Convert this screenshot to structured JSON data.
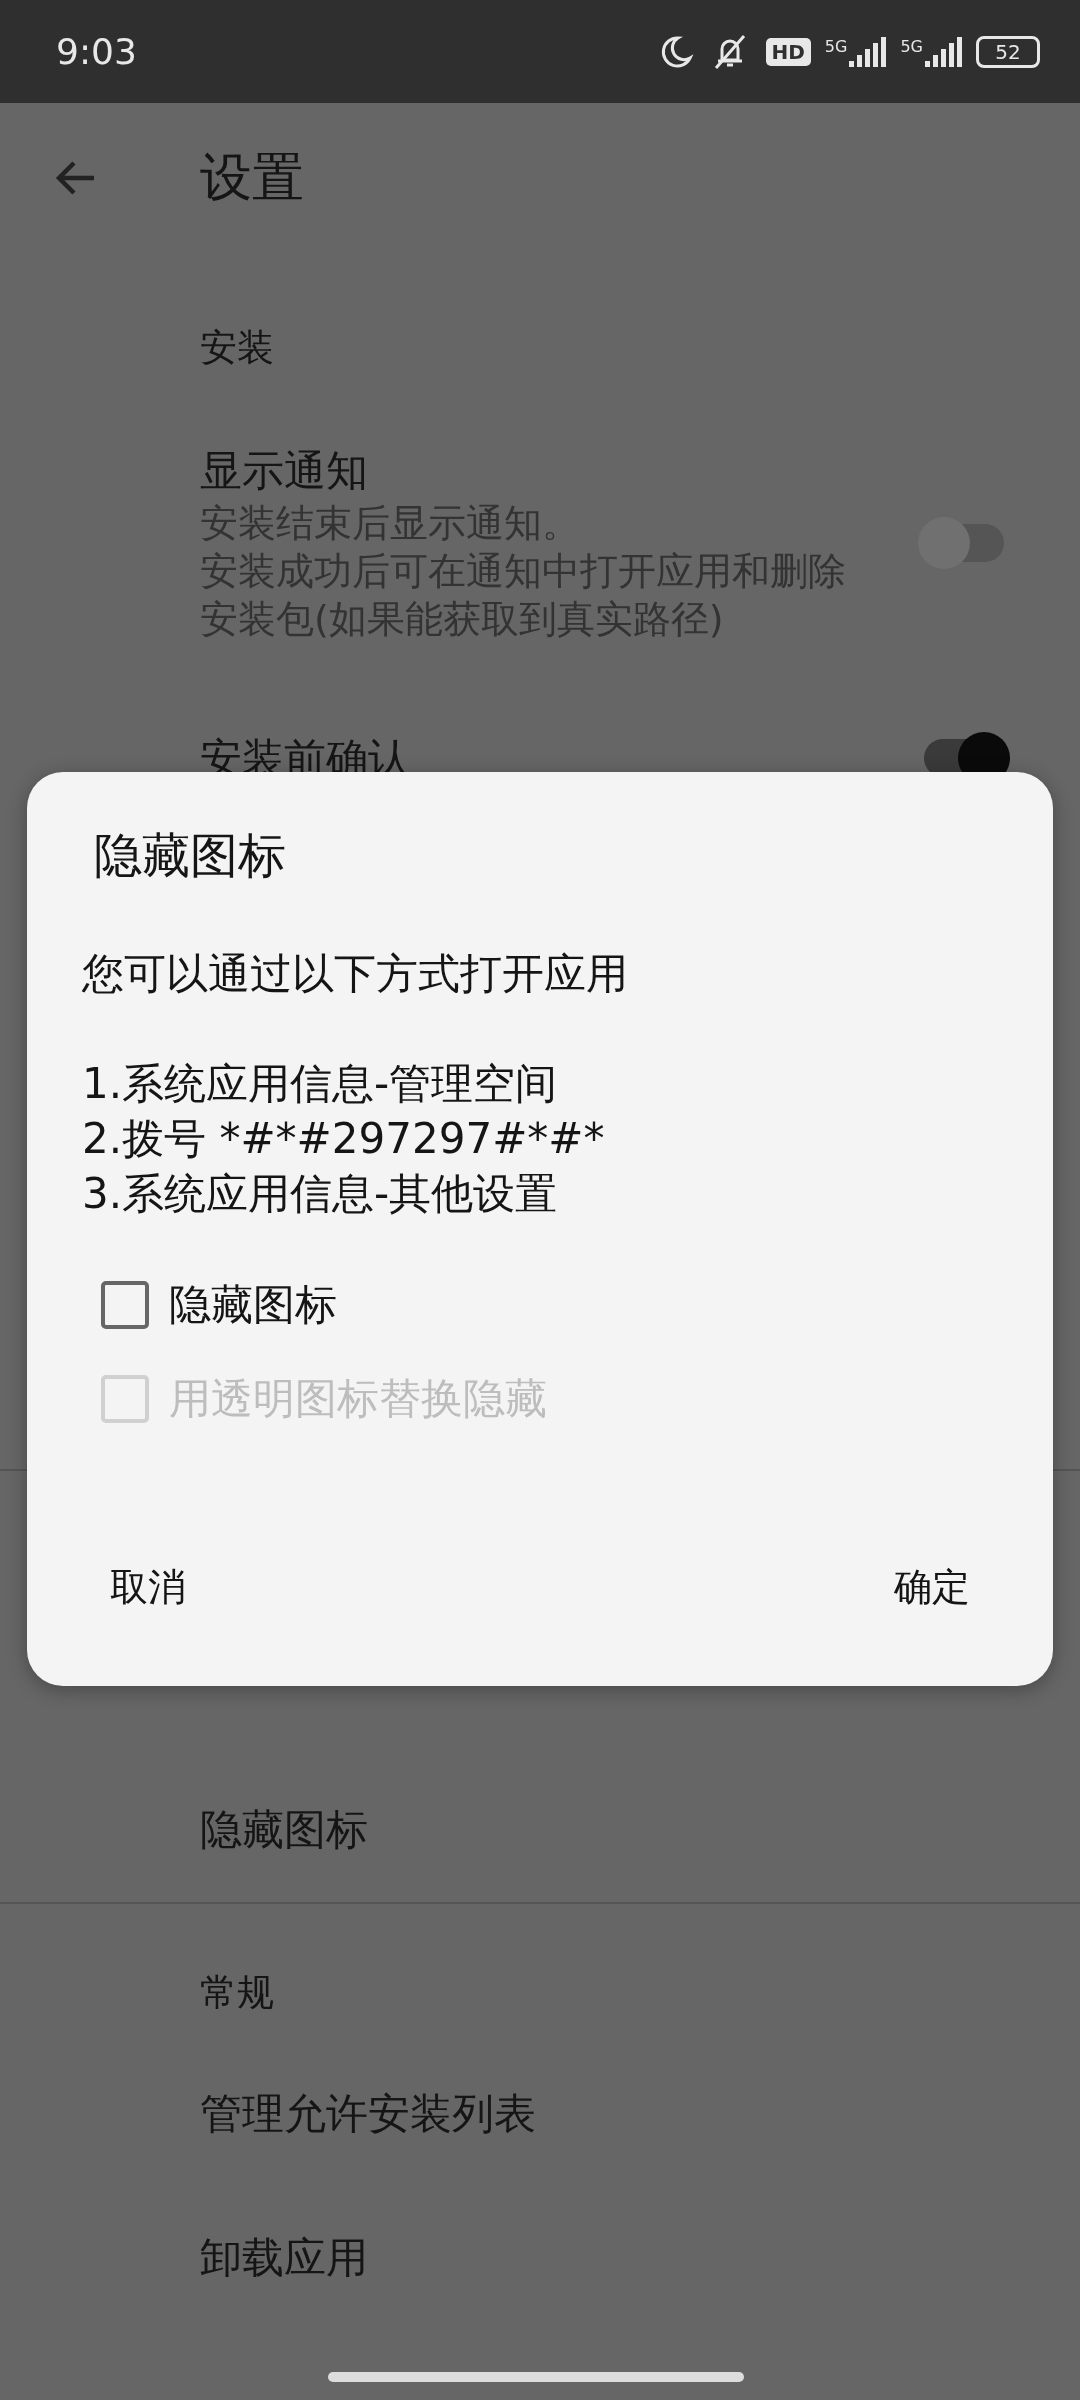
{
  "status_bar": {
    "time": "9:03",
    "hd": "HD",
    "networks": [
      "5G",
      "5G"
    ],
    "battery": "52"
  },
  "toolbar": {
    "title": "设置"
  },
  "items": [
    {
      "kind": "header",
      "title": "安装"
    },
    {
      "kind": "switch",
      "title": "显示通知",
      "subtitle_lines": [
        "安装结束后显示通知。",
        "安装成功后可在通知中打开应用和删除",
        "安装包(如果能获取到真实路径)"
      ],
      "on": false
    },
    {
      "kind": "switch",
      "title": "安装前确认",
      "on": true
    },
    {
      "kind": "divider"
    },
    {
      "kind": "plain",
      "title": "隐藏图标"
    },
    {
      "kind": "divider"
    },
    {
      "kind": "header",
      "title": "常规"
    },
    {
      "kind": "plain",
      "title": "管理允许安装列表"
    },
    {
      "kind": "plain",
      "title": "卸载应用"
    }
  ],
  "dialog": {
    "title": "隐藏图标",
    "message": "您可以通过以下方式打开应用\n\n1.系统应用信息-管理空间\n2.拨号 *#*#297297#*#*\n3.系统应用信息-其他设置",
    "options": [
      {
        "label": "隐藏图标",
        "checked": false,
        "disabled": false
      },
      {
        "label": "用透明图标替换隐藏",
        "checked": false,
        "disabled": true
      }
    ],
    "buttons": [
      "取消",
      "确定"
    ]
  }
}
